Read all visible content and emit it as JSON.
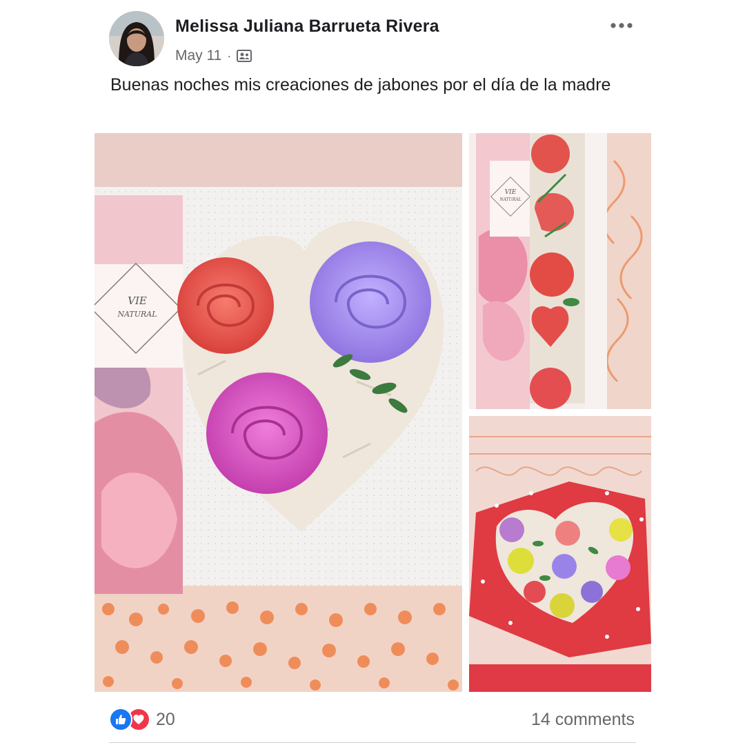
{
  "post": {
    "author": "Melissa Juliana Barrueta Rivera",
    "date": "May 11",
    "separator": "·",
    "audience_icon": "friends-icon",
    "caption": "Buenas noches mis creaciones de jabones por el día de la madre"
  },
  "photos": {
    "main": {
      "box_label_line1": "VIE",
      "box_label_line2": "NATURAL"
    },
    "top_right": {
      "box_label_line1": "VIE",
      "box_label_line2": "NATURAL"
    }
  },
  "footer": {
    "reaction_icons": [
      "like-icon",
      "love-icon"
    ],
    "reaction_count": "20",
    "comments": "14 comments"
  },
  "colors": {
    "like_blue": "#1877f2",
    "love_red": "#f0364a",
    "secondary_text": "#65676b"
  }
}
